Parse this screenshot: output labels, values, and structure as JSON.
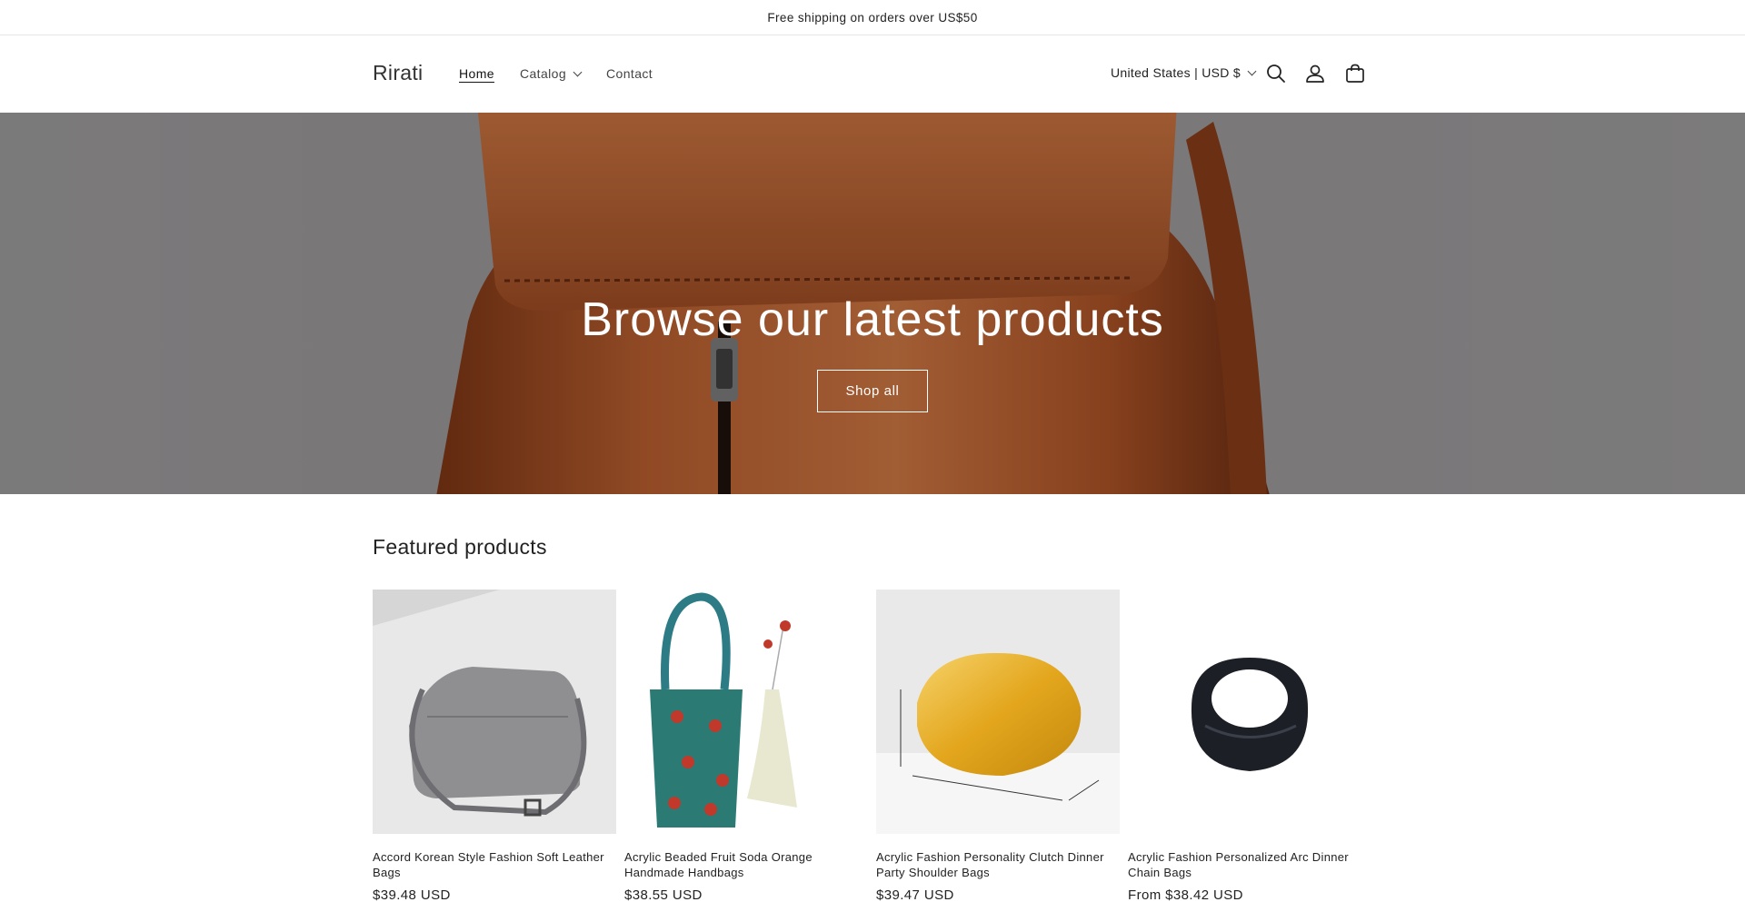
{
  "announcement": "Free shipping on orders over US$50",
  "header": {
    "logo": "Rirati",
    "nav": [
      {
        "label": "Home"
      },
      {
        "label": "Catalog"
      },
      {
        "label": "Contact"
      }
    ],
    "country": "United States | USD $",
    "icons": [
      "search-icon",
      "account-icon",
      "cart-icon"
    ]
  },
  "hero": {
    "title": "Browse our latest products",
    "button": "Shop all"
  },
  "featured": {
    "title": "Featured products",
    "products": [
      {
        "name": "Accord Korean Style Fashion Soft Leather Bags",
        "price": "$39.48 USD"
      },
      {
        "name": "Acrylic Beaded Fruit Soda Orange Handmade Handbags",
        "price": "$38.55 USD"
      },
      {
        "name": "Acrylic Fashion Personality Clutch Dinner Party Shoulder Bags",
        "price": "$39.47 USD"
      },
      {
        "name": "Acrylic Fashion Personalized Arc Dinner Chain Bags",
        "price": "From $38.42 USD"
      }
    ]
  },
  "colors": {
    "text": "#121212",
    "hero_overlay_text": "#ffffff",
    "leather": "#a4542a"
  }
}
